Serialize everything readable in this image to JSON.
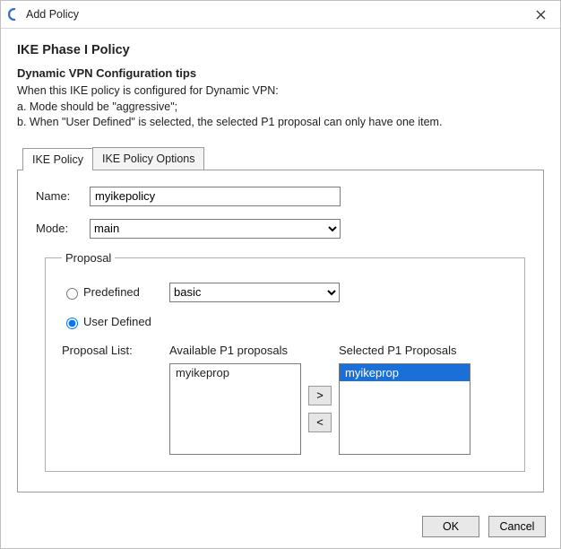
{
  "window": {
    "title": "Add Policy"
  },
  "header": {
    "title": "IKE Phase I Policy",
    "tips_title": "Dynamic VPN Configuration tips",
    "tips": [
      "When this IKE policy is configured for Dynamic VPN:",
      "a. Mode should be \"aggressive\";",
      "b. When \"User Defined\" is selected, the selected P1 proposal can  only have one item."
    ]
  },
  "tabs": [
    {
      "label": "IKE Policy"
    },
    {
      "label": "IKE Policy Options"
    }
  ],
  "form": {
    "name_label": "Name:",
    "name_value": "myikepolicy",
    "mode_label": "Mode:",
    "mode_value": "main"
  },
  "proposal": {
    "legend": "Proposal",
    "predefined_label": "Predefined",
    "predefined_value": "basic",
    "userdefined_label": "User Defined",
    "list_label": "Proposal List:",
    "available_title": "Available P1 proposals",
    "selected_title": "Selected P1 Proposals",
    "available": [
      "myikeprop"
    ],
    "selected": [
      "myikeprop"
    ],
    "btn_right": ">",
    "btn_left": "<"
  },
  "footer": {
    "ok": "OK",
    "cancel": "Cancel"
  }
}
